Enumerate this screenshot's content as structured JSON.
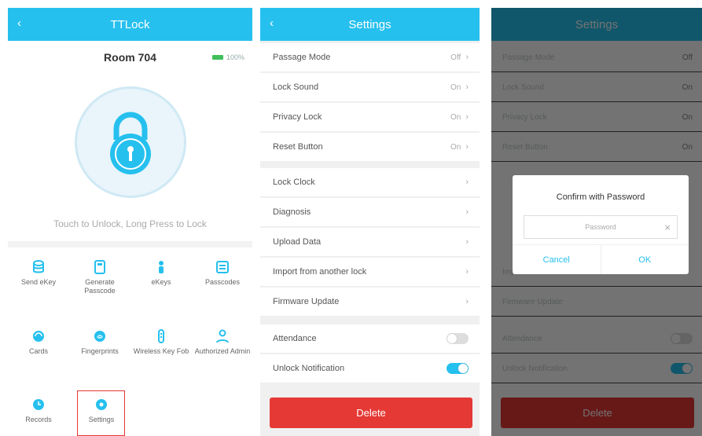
{
  "colors": {
    "accent": "#26c0ee",
    "danger": "#e53935",
    "battery": "#3fbf5a"
  },
  "home": {
    "title": "TTLock",
    "back_icon": "arrow-left-icon",
    "room": "Room 704",
    "battery": "100%",
    "hint": "Touch to Unlock, Long Press to Lock",
    "grid": [
      {
        "label": "Send eKey",
        "icon": "database-icon"
      },
      {
        "label": "Generate Passcode",
        "icon": "keypad-icon"
      },
      {
        "label": "eKeys",
        "icon": "person-icon"
      },
      {
        "label": "Passcodes",
        "icon": "list-icon"
      },
      {
        "label": "Cards",
        "icon": "card-icon"
      },
      {
        "label": "Fingerprints",
        "icon": "fingerprint-icon"
      },
      {
        "label": "Wireless Key Fob",
        "icon": "remote-icon"
      },
      {
        "label": "Authorized Admin",
        "icon": "admin-icon"
      },
      {
        "label": "Records",
        "icon": "clock-icon"
      },
      {
        "label": "Settings",
        "icon": "gear-icon"
      }
    ]
  },
  "settings": {
    "title": "Settings",
    "rows": [
      {
        "label": "Passage Mode",
        "value": "Off"
      },
      {
        "label": "Lock Sound",
        "value": "On"
      },
      {
        "label": "Privacy Lock",
        "value": "On"
      },
      {
        "label": "Reset Button",
        "value": "On"
      },
      {
        "label": "Lock Clock",
        "value": ""
      },
      {
        "label": "Diagnosis",
        "value": ""
      },
      {
        "label": "Upload Data",
        "value": ""
      },
      {
        "label": "Import from another lock",
        "value": ""
      },
      {
        "label": "Firmware Update",
        "value": ""
      }
    ],
    "toggles": [
      {
        "label": "Attendance",
        "on": false
      },
      {
        "label": "Unlock Notification",
        "on": true
      }
    ],
    "delete_label": "Delete"
  },
  "dialog": {
    "title": "Confirm with Password",
    "placeholder": "Password",
    "cancel": "Cancel",
    "ok": "OK"
  }
}
